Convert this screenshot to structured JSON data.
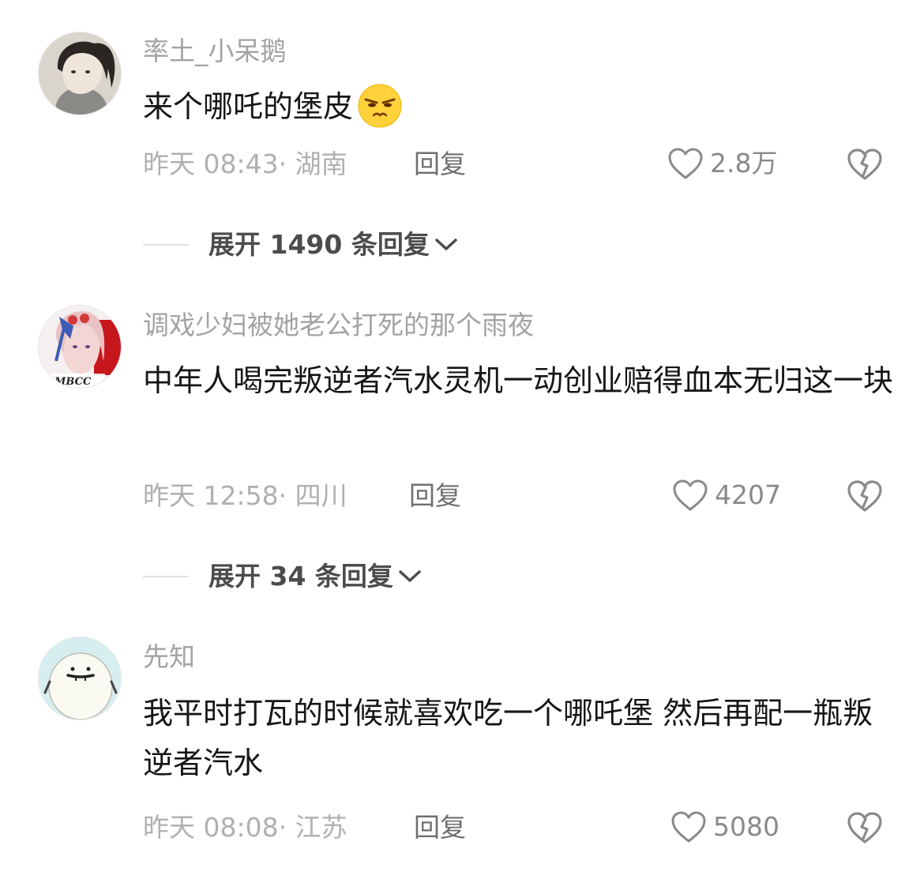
{
  "comments": [
    {
      "username": "率土_小呆鹅",
      "text": "来个哪吒的堡皮",
      "emoji": "smirk-face-emoji",
      "time": "昨天 08:43",
      "location": "湖南",
      "meta": "昨天 08:43· 湖南",
      "reply_label": "回复",
      "likes": "2.8万",
      "expand_label": "展开 1490 条回复"
    },
    {
      "username": "调戏少妇被她老公打死的那个雨夜",
      "text": "中年人喝完叛逆者汽水灵机一动创业赔得血本无归这一块",
      "avatar_text": "MBCC",
      "time": "昨天 12:58",
      "location": "四川",
      "meta": "昨天 12:58· 四川",
      "reply_label": "回复",
      "likes": "4207",
      "expand_label": "展开 34 条回复"
    },
    {
      "username": "先知",
      "text": "我平时打瓦的时候就喜欢吃一个哪吒堡 然后再配一瓶叛逆者汽水",
      "time": "昨天 08:08",
      "location": "江苏",
      "meta": "昨天 08:08· 江苏",
      "reply_label": "回复",
      "likes": "5080"
    }
  ],
  "icons": {
    "like": "heart-outline-icon",
    "dislike": "broken-heart-icon",
    "expand": "chevron-down-icon"
  },
  "colors": {
    "username": "#a3a3a3",
    "text": "#161616",
    "meta": "#b0b0b0",
    "reply": "#6f6f6f",
    "expand": "#4c4c4c"
  }
}
